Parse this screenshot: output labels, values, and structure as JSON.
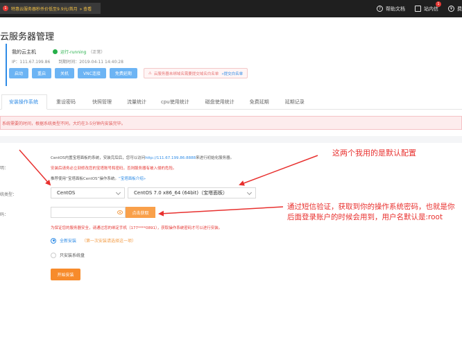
{
  "topbar": {
    "promo_number": "1",
    "promo_text": "特惠云服务器秒杀价低至9.9元/首月",
    "promo_link": "» 查看",
    "help_label": "帮助文档",
    "inbox_label": "站内信",
    "inbox_badge": "1",
    "more_label": "费"
  },
  "page": {
    "title": "云服务器管理"
  },
  "server": {
    "name": "我的云主机",
    "status": "运行-running",
    "status_note": "（正常）",
    "ip": "IP：111.67.199.86",
    "expires": "到期时间：2019-04-11 14:40:28",
    "buttons": [
      "启动",
      "重启",
      "关机",
      "VNC连接",
      "免费延期"
    ],
    "tip": "云服务器未绑域名需要提交域名白名单",
    "tip_link": "»提交白名单"
  },
  "tabs": [
    "安装操作系统",
    "重设密码",
    "快照管理",
    "流量统计",
    "cpu使用统计",
    "磁盘使用统计",
    "免费延期",
    "延期记录"
  ],
  "alert": "系统需要的时间，根据系统类型不同，大约在3-5分钟内安装完毕。",
  "form": {
    "desc_label": "明：",
    "desc_line1": "CentOS内置宝塔面板的系统，安装完后后，您可以访问",
    "desc_line1_link": "http://111.67.199.86:8888",
    "desc_line1_tail": "来进行初始化服务器。",
    "desc_line2": "安装后请务必立刻修改您的宝塔账号和密码，否则服务器有被入侵的危险。",
    "desc_line3": "推荐使用“宝塔面板CentOS”操作系统。",
    "desc_line3_link": "“宝塔面板介绍»",
    "os_type_label": "统类型：",
    "os_family": "CentOS",
    "os_version": "CentOS 7.0 x86_64 (64bit)（宝塔面板）",
    "password_label": "码：",
    "password_value": "",
    "get_code_button": "点击获取",
    "sms_notice": "为保证您的服务器安全，请通过您的绑定手机（177****0891），获取操作系统密码才可以进行安装。",
    "radio_full": "全新安装",
    "radio_full_note": "（第一次安装请选择这一项）",
    "radio_system_only": "只安装系统盘",
    "install_button": "开始安装"
  },
  "annotations": {
    "note1": "这两个我用的是默认配置",
    "note2_line1": "通过短信验证，获取到你的操作系统密码，也就是你",
    "note2_line2": "后面登录账户的时候会用到，用户名默认是:root"
  },
  "colors": {
    "annotation": "#e8302e",
    "primary": "#2e8be6",
    "orange": "#f78b2b",
    "status_green": "#26b04a"
  }
}
